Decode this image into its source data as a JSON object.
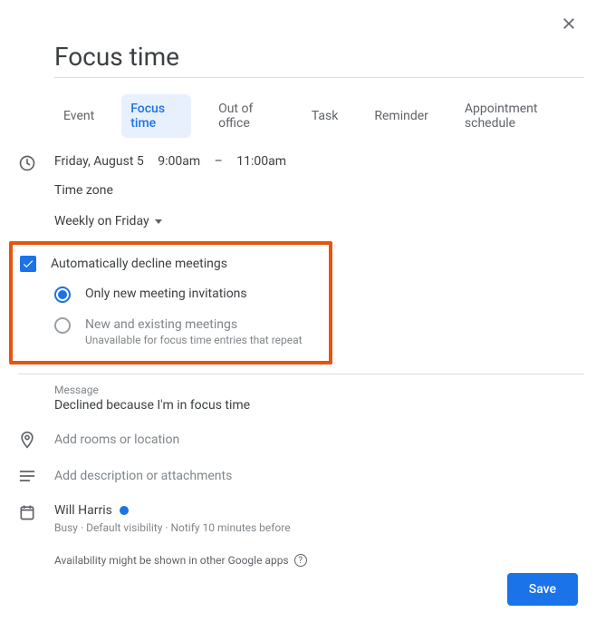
{
  "title": "Focus time",
  "tabs": {
    "event": "Event",
    "focus_time": "Focus time",
    "out_of_office": "Out of office",
    "task": "Task",
    "reminder": "Reminder",
    "appointment": "Appointment schedule"
  },
  "datetime": {
    "date": "Friday, August 5",
    "start": "9:00am",
    "dash": "–",
    "end": "11:00am",
    "timezone_link": "Time zone",
    "recurrence": "Weekly on Friday"
  },
  "auto_decline": {
    "label": "Automatically decline meetings",
    "checked": true,
    "options": {
      "new_only": "Only new meeting invitations",
      "new_existing": "New and existing meetings",
      "new_existing_sub": "Unavailable for focus time entries that repeat"
    },
    "selected": "new_only"
  },
  "message": {
    "label": "Message",
    "value": "Declined because I'm in focus time"
  },
  "location_placeholder": "Add rooms or location",
  "description_placeholder": "Add description or attachments",
  "calendar": {
    "owner": "Will Harris",
    "busy": "Busy",
    "visibility": "Default visibility",
    "notify": "Notify 10 minutes before"
  },
  "availability_note": "Availability might be shown in other Google apps",
  "save_label": "Save"
}
